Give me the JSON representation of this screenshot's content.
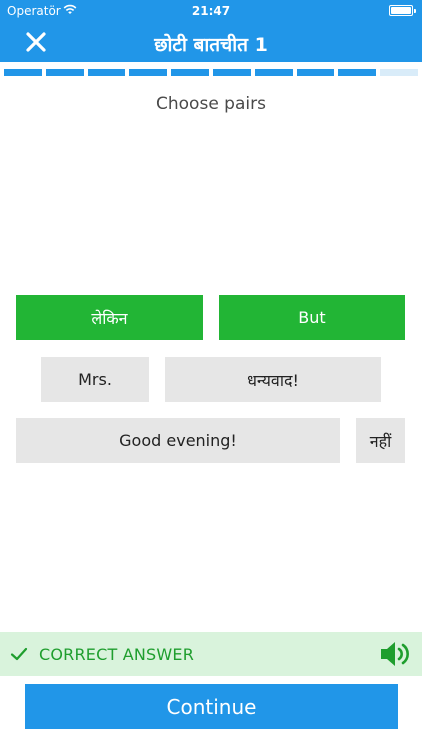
{
  "status_bar": {
    "carrier": "Operatör",
    "time": "21:47"
  },
  "header": {
    "title": "छोटी बातचीत 1",
    "close_icon": "close-icon"
  },
  "progress": {
    "segments_total": 10,
    "segments_completed": 9
  },
  "instruction": "Choose pairs",
  "tiles": [
    {
      "label": "लेकिन",
      "state": "matched"
    },
    {
      "label": "But",
      "state": "matched"
    },
    {
      "label": "Mrs.",
      "state": "default"
    },
    {
      "label": "धन्यवाद!",
      "state": "default"
    },
    {
      "label": "Good evening!",
      "state": "default"
    },
    {
      "label": "नहीं",
      "state": "default"
    }
  ],
  "feedback": {
    "text": "CORRECT ANSWER",
    "icon": "checkmark-icon",
    "audio_icon": "speaker-icon"
  },
  "continue_label": "Continue",
  "colors": {
    "primary_blue": "#2196e8",
    "match_green": "#22b535",
    "tile_gray": "#e6e6e6",
    "feedback_bg": "#d9f3dc",
    "feedback_text": "#1f9e2e"
  }
}
